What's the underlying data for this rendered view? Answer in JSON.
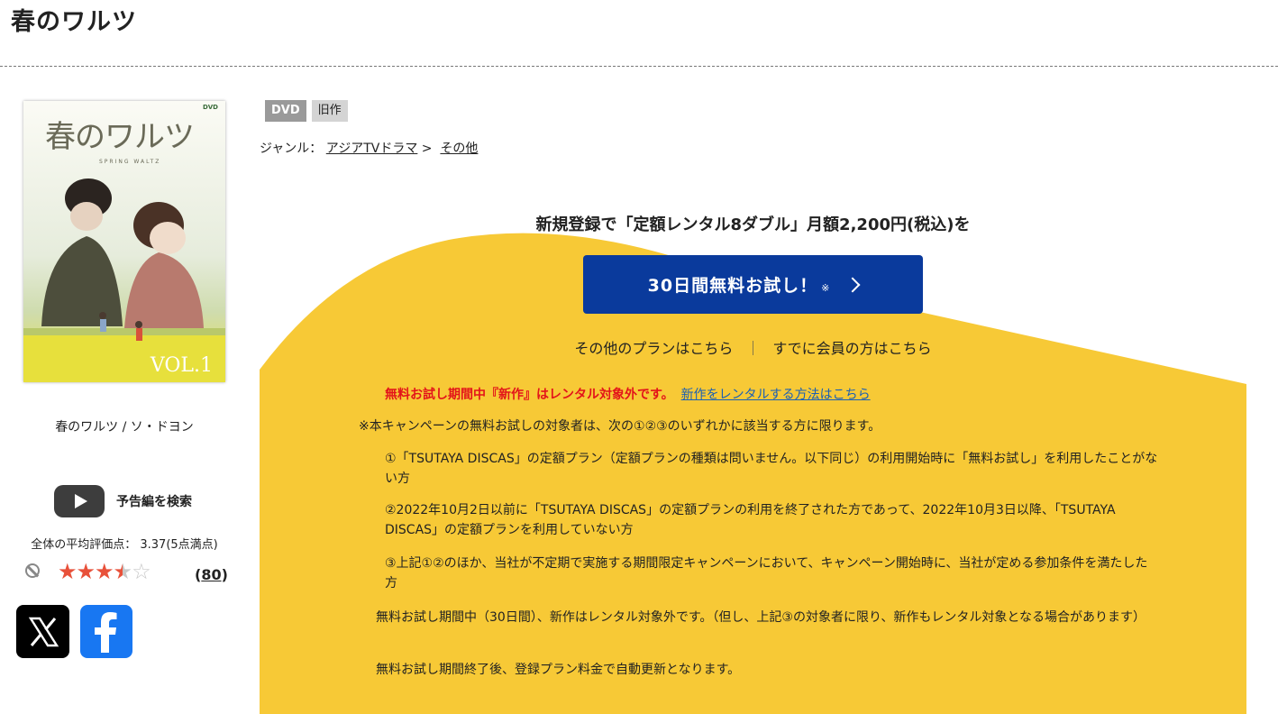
{
  "title": "春のワルツ",
  "cover": {
    "title_text": "春のワルツ",
    "subtitle_text": "SPRING WALTZ",
    "vol_text": "VOL.1",
    "brand_text": "DVD"
  },
  "cover_caption": "春のワルツ / ソ・ドヨン",
  "trailer_label": "予告編を検索",
  "rating": {
    "label": "全体の平均評価点： 3.37(5点満点)",
    "value": 3.37,
    "max": 5,
    "count_open": "(",
    "count": "80",
    "count_close": ")"
  },
  "badges": {
    "format": "DVD",
    "status": "旧作"
  },
  "genre": {
    "label": "ジャンル：",
    "crumb1": "アジアTVドラマ",
    "arrow": ">",
    "crumb2": "その他"
  },
  "promo": {
    "heading": "新規登録で「定額レンタル8ダブル」月額2,200円(税込)を",
    "button_label": "30日間無料お試し！",
    "button_mark": "※",
    "other_plans": "その他のプランはこちら",
    "separator": "｜",
    "member_link": "すでに会員の方はこちら",
    "notice_red": "無料お試し期間中『新作』はレンタル対象外です。",
    "notice_link": "新作をレンタルする方法はこちら",
    "conditions_intro": "※本キャンペーンの無料お試しの対象者は、次の①②③のいずれかに該当する方に限ります。",
    "conditions": [
      "①「TSUTAYA DISCAS」の定額プラン（定額プランの種類は問いません。以下同じ）の利用開始時に「無料お試し」を利用したことがない方",
      "②2022年10月2日以前に「TSUTAYA DISCAS」の定額プランの利用を終了された方であって、2022年10月3日以降、「TSUTAYA DISCAS」の定額プランを利用していない方",
      "③上記①②のほか、当社が不定期で実施する期間限定キャンペーンにおいて、キャンペーン開始時に、当社が定める参加条件を満たした方"
    ],
    "note1": "無料お試し期間中（30日間）、新作はレンタル対象外です。（但し、上記③の対象者に限り、新作もレンタル対象となる場合があります）",
    "note2": "無料お試し期間終了後、登録プラン料金で自動更新となります。"
  },
  "colors": {
    "accent_yellow": "#f7c936",
    "button_blue": "#0a3a9c",
    "notice_red": "#e3141a",
    "link_blue": "#1a5fb4",
    "star_red": "#e8513a"
  },
  "icons": {
    "trailer": "youtube-play-icon",
    "no_rating": "prohibited-icon",
    "share_x": "x-logo-icon",
    "share_facebook": "facebook-logo-icon",
    "button_arrow": "chevron-right-icon"
  }
}
